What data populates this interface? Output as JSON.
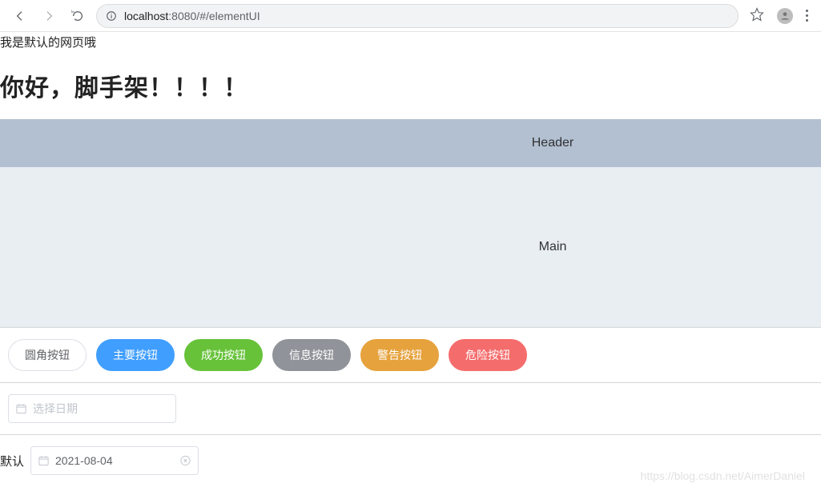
{
  "browser": {
    "url_host": "localhost",
    "url_port_path": ":8080/#/elementUI"
  },
  "page": {
    "default_text": "我是默认的网页哦",
    "title": "你好，脚手架！！！！"
  },
  "layout": {
    "header": "Header",
    "main": "Main"
  },
  "buttons": {
    "round": "圆角按钮",
    "primary": "主要按钮",
    "success": "成功按钮",
    "info": "信息按钮",
    "warning": "警告按钮",
    "danger": "危险按钮"
  },
  "datepicker": {
    "placeholder": "选择日期",
    "label": "默认",
    "value": "2021-08-04"
  },
  "watermark": "https://blog.csdn.net/AimerDaniel"
}
